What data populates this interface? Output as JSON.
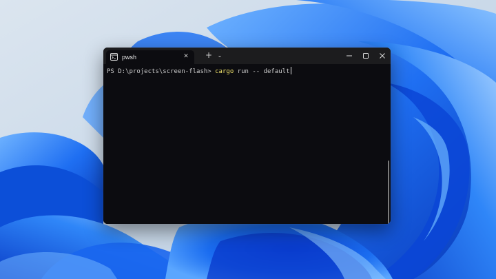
{
  "window": {
    "tab_title": "pwsh",
    "tab_close_glyph": "✕",
    "new_tab_glyph": "+",
    "dropdown_glyph": "⌄"
  },
  "terminal": {
    "prompt": "PS D:\\projects\\screen-flash> ",
    "command": "cargo",
    "args": " run -- default"
  },
  "icons": {
    "tab": "terminal-icon",
    "minimize": "minimize-icon",
    "maximize": "maximize-icon",
    "close": "close-icon"
  },
  "colors": {
    "terminal_bg": "#0c0c10",
    "titlebar_bg": "#1c1c1e",
    "command_text": "#f1e36c",
    "default_text": "#cccccc"
  }
}
